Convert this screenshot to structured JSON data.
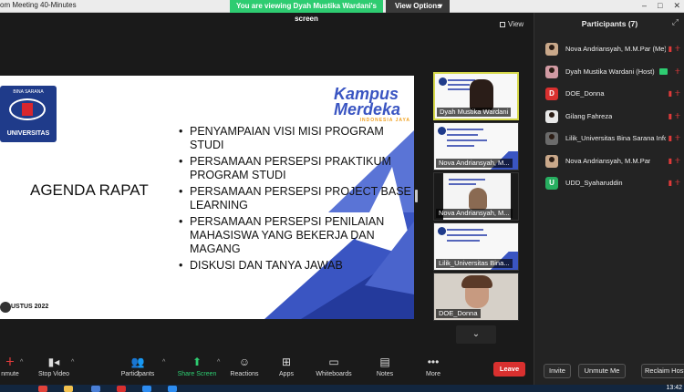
{
  "window": {
    "title": "om Meeting 40-Minutes",
    "controls": [
      "–",
      "□",
      "✕"
    ]
  },
  "share_banner": "You are viewing Dyah Mustika Wardani's screen",
  "view_options": {
    "label": "View Options",
    "caret": "▾"
  },
  "view_button": "View",
  "slide": {
    "university_badge": "UNIVERSITAS",
    "kampus_line1": "Kampus",
    "kampus_line2": "Merdeka",
    "kampus_tagline": "INDONESIA JAYA",
    "title": "AGENDA RAPAT",
    "items": [
      "PENYAMPAIAN VISI MISI PROGRAM STUDI",
      "PERSAMAAN PERSEPSI PRAKTIKUM PROGRAM STUDI",
      "PERSAMAAN PERSEPSI PROJECT BASE LEARNING",
      "PERSAMAAN PERSEPSI PENILAIAN MAHASISWA YANG BEKERJA DAN MAGANG",
      "DISKUSI DAN TANYA JAWAB"
    ],
    "date_text": "USTUS 2022"
  },
  "tiles": [
    {
      "name": "Dyah Mustika Wardani",
      "active": true,
      "kind": "person-slide"
    },
    {
      "name": "Nova Andriansyah, M...",
      "active": false,
      "kind": "slide"
    },
    {
      "name": "Nova Andriansyah, M...",
      "active": false,
      "kind": "person"
    },
    {
      "name": "Lilik_Universitas Bina...",
      "active": false,
      "kind": "slide"
    },
    {
      "name": "DOE_Donna",
      "active": false,
      "kind": "face"
    }
  ],
  "tile_scroll": "⌄",
  "participants": {
    "title": "Participants (7)",
    "close": "⤢",
    "list": [
      {
        "name": "Nova Andriansyah, M.M.Par (Me)",
        "avatar_type": "photo",
        "initial": "",
        "color": "#c9a88a",
        "mic_muted": true,
        "video_off": true,
        "sharing": false
      },
      {
        "name": "Dyah Mustika Wardani (Host)",
        "avatar_type": "photo",
        "initial": "",
        "color": "#d19aa3",
        "mic_muted": true,
        "video_off": false,
        "sharing": true
      },
      {
        "name": "DOE_Donna",
        "avatar_type": "initial",
        "initial": "D",
        "color": "#d9302f",
        "mic_muted": true,
        "video_off": true,
        "sharing": false
      },
      {
        "name": "Gilang Fahreza",
        "avatar_type": "photo",
        "initial": "",
        "color": "#e8e8e8",
        "mic_muted": true,
        "video_off": true,
        "sharing": false
      },
      {
        "name": "Lilik_Universitas Bina Sarana Info...",
        "avatar_type": "photo",
        "initial": "",
        "color": "#6b6b6b",
        "mic_muted": true,
        "video_off": true,
        "sharing": false
      },
      {
        "name": "Nova Andriansyah, M.M.Par",
        "avatar_type": "photo",
        "initial": "",
        "color": "#c9a88a",
        "mic_muted": true,
        "video_off": true,
        "sharing": false
      },
      {
        "name": "UDD_Syaharuddin",
        "avatar_type": "initial",
        "initial": "U",
        "color": "#27ae60",
        "mic_muted": true,
        "video_off": true,
        "sharing": false
      }
    ],
    "footer": {
      "invite": "Invite",
      "unmute_me": "Unmute Me",
      "reclaim_host": "Reclaim Host"
    }
  },
  "toolbar": {
    "unmute": "nmute",
    "stop_video": "Stop Video",
    "participants": "Participants",
    "participants_count": "7",
    "share_screen": "Share Screen",
    "reactions": "Reactions",
    "apps": "Apps",
    "whiteboards": "Whiteboards",
    "notes": "Notes",
    "more": "More",
    "leave": "Leave"
  },
  "taskbar": {
    "clock": "13:42"
  },
  "colors": {
    "accent_green": "#2ecc71",
    "leave_red": "#d9302f",
    "slide_blue": "#3a55c2",
    "panel_bg": "#232323"
  }
}
